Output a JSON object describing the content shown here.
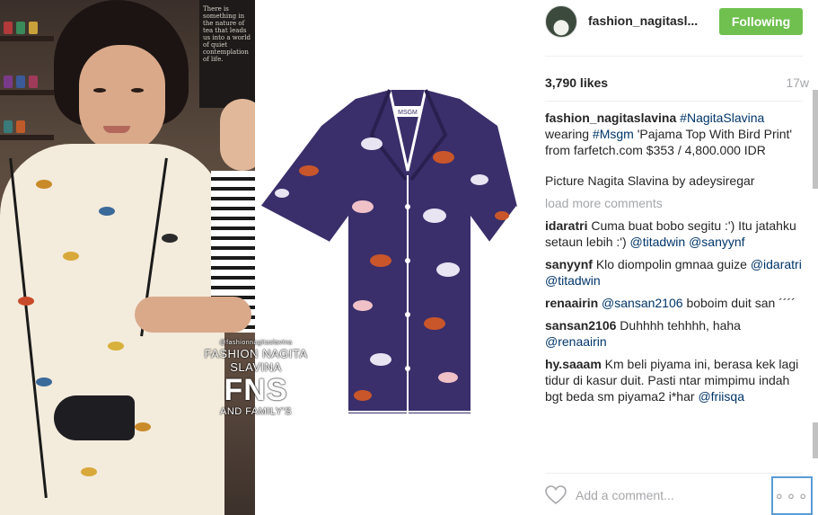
{
  "post": {
    "watermark": {
      "handle": "@fashionnagitaslavina",
      "name": "FASHION NAGITA SLAVINA",
      "logo": "FNS",
      "family": "AND FAMILY'S"
    },
    "quote_board_text": "There is something in the nature of tea that leads us into a world of quiet contemplation of life.",
    "product_label": "MSGM"
  },
  "header": {
    "username": "fashion_nagitasl...",
    "follow_label": "Following",
    "follow_color": "#70c050"
  },
  "stats": {
    "likes": "3,790 likes",
    "age": "17w"
  },
  "caption": {
    "user": "fashion_nagitaslavina",
    "tag1": "#NagitaSlavina",
    "t1": "wearing",
    "tag2": "#Msgm",
    "t2": "'Pajama Top With Bird Print' from farfetch.com $353 / 4,800.000 IDR",
    "credit": "Picture Nagita Slavina by adeysiregar"
  },
  "load_more": "load more comments",
  "comments": [
    {
      "user": "idaratri",
      "text": "Cuma buat bobo segitu :') Itu jatahku setaun lebih :')",
      "tags": [
        "@titadwin",
        "@sanyynf"
      ]
    },
    {
      "user": "sanyynf",
      "text": "Klo diompolin gmnaa guize",
      "tags": [
        "@idaratri",
        "@titadwin"
      ]
    },
    {
      "user": "renaairin",
      "text_before": "",
      "tag_before": "@sansan2106",
      "text": "boboim duit san",
      "tail": "´´´´"
    },
    {
      "user": "sansan2106",
      "text": "Duhhhh tehhhh, haha",
      "tags": [
        "@renaairin"
      ]
    },
    {
      "user": "hy.saaam",
      "text": "Km beli piyama ini, berasa kek lagi tidur di kasur duit. Pasti ntar mimpimu indah bgt beda sm piyama2 i*har",
      "tags": [
        "@friisqa"
      ]
    }
  ],
  "footer": {
    "comment_placeholder": "Add a comment...",
    "more_label": "∘∘∘",
    "heart_icon": "heart-outline-icon"
  },
  "colors": {
    "link": "#003569",
    "muted": "#a5a7aa",
    "shirt_navy": "#3a2f6b"
  }
}
